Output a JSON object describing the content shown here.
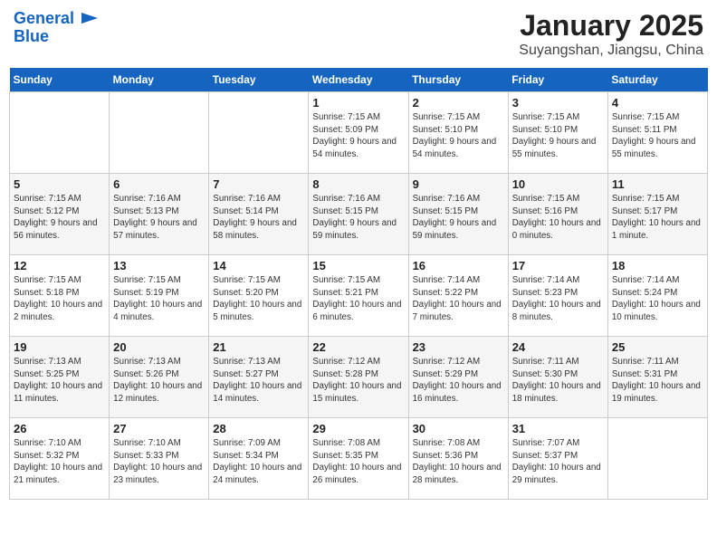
{
  "header": {
    "logo_line1": "General",
    "logo_line2": "Blue",
    "title": "January 2025",
    "subtitle": "Suyangshan, Jiangsu, China"
  },
  "days_of_week": [
    "Sunday",
    "Monday",
    "Tuesday",
    "Wednesday",
    "Thursday",
    "Friday",
    "Saturday"
  ],
  "weeks": [
    [
      {
        "day": "",
        "info": ""
      },
      {
        "day": "",
        "info": ""
      },
      {
        "day": "",
        "info": ""
      },
      {
        "day": "1",
        "info": "Sunrise: 7:15 AM\nSunset: 5:09 PM\nDaylight: 9 hours and 54 minutes."
      },
      {
        "day": "2",
        "info": "Sunrise: 7:15 AM\nSunset: 5:10 PM\nDaylight: 9 hours and 54 minutes."
      },
      {
        "day": "3",
        "info": "Sunrise: 7:15 AM\nSunset: 5:10 PM\nDaylight: 9 hours and 55 minutes."
      },
      {
        "day": "4",
        "info": "Sunrise: 7:15 AM\nSunset: 5:11 PM\nDaylight: 9 hours and 55 minutes."
      }
    ],
    [
      {
        "day": "5",
        "info": "Sunrise: 7:15 AM\nSunset: 5:12 PM\nDaylight: 9 hours and 56 minutes."
      },
      {
        "day": "6",
        "info": "Sunrise: 7:16 AM\nSunset: 5:13 PM\nDaylight: 9 hours and 57 minutes."
      },
      {
        "day": "7",
        "info": "Sunrise: 7:16 AM\nSunset: 5:14 PM\nDaylight: 9 hours and 58 minutes."
      },
      {
        "day": "8",
        "info": "Sunrise: 7:16 AM\nSunset: 5:15 PM\nDaylight: 9 hours and 59 minutes."
      },
      {
        "day": "9",
        "info": "Sunrise: 7:16 AM\nSunset: 5:15 PM\nDaylight: 9 hours and 59 minutes."
      },
      {
        "day": "10",
        "info": "Sunrise: 7:15 AM\nSunset: 5:16 PM\nDaylight: 10 hours and 0 minutes."
      },
      {
        "day": "11",
        "info": "Sunrise: 7:15 AM\nSunset: 5:17 PM\nDaylight: 10 hours and 1 minute."
      }
    ],
    [
      {
        "day": "12",
        "info": "Sunrise: 7:15 AM\nSunset: 5:18 PM\nDaylight: 10 hours and 2 minutes."
      },
      {
        "day": "13",
        "info": "Sunrise: 7:15 AM\nSunset: 5:19 PM\nDaylight: 10 hours and 4 minutes."
      },
      {
        "day": "14",
        "info": "Sunrise: 7:15 AM\nSunset: 5:20 PM\nDaylight: 10 hours and 5 minutes."
      },
      {
        "day": "15",
        "info": "Sunrise: 7:15 AM\nSunset: 5:21 PM\nDaylight: 10 hours and 6 minutes."
      },
      {
        "day": "16",
        "info": "Sunrise: 7:14 AM\nSunset: 5:22 PM\nDaylight: 10 hours and 7 minutes."
      },
      {
        "day": "17",
        "info": "Sunrise: 7:14 AM\nSunset: 5:23 PM\nDaylight: 10 hours and 8 minutes."
      },
      {
        "day": "18",
        "info": "Sunrise: 7:14 AM\nSunset: 5:24 PM\nDaylight: 10 hours and 10 minutes."
      }
    ],
    [
      {
        "day": "19",
        "info": "Sunrise: 7:13 AM\nSunset: 5:25 PM\nDaylight: 10 hours and 11 minutes."
      },
      {
        "day": "20",
        "info": "Sunrise: 7:13 AM\nSunset: 5:26 PM\nDaylight: 10 hours and 12 minutes."
      },
      {
        "day": "21",
        "info": "Sunrise: 7:13 AM\nSunset: 5:27 PM\nDaylight: 10 hours and 14 minutes."
      },
      {
        "day": "22",
        "info": "Sunrise: 7:12 AM\nSunset: 5:28 PM\nDaylight: 10 hours and 15 minutes."
      },
      {
        "day": "23",
        "info": "Sunrise: 7:12 AM\nSunset: 5:29 PM\nDaylight: 10 hours and 16 minutes."
      },
      {
        "day": "24",
        "info": "Sunrise: 7:11 AM\nSunset: 5:30 PM\nDaylight: 10 hours and 18 minutes."
      },
      {
        "day": "25",
        "info": "Sunrise: 7:11 AM\nSunset: 5:31 PM\nDaylight: 10 hours and 19 minutes."
      }
    ],
    [
      {
        "day": "26",
        "info": "Sunrise: 7:10 AM\nSunset: 5:32 PM\nDaylight: 10 hours and 21 minutes."
      },
      {
        "day": "27",
        "info": "Sunrise: 7:10 AM\nSunset: 5:33 PM\nDaylight: 10 hours and 23 minutes."
      },
      {
        "day": "28",
        "info": "Sunrise: 7:09 AM\nSunset: 5:34 PM\nDaylight: 10 hours and 24 minutes."
      },
      {
        "day": "29",
        "info": "Sunrise: 7:08 AM\nSunset: 5:35 PM\nDaylight: 10 hours and 26 minutes."
      },
      {
        "day": "30",
        "info": "Sunrise: 7:08 AM\nSunset: 5:36 PM\nDaylight: 10 hours and 28 minutes."
      },
      {
        "day": "31",
        "info": "Sunrise: 7:07 AM\nSunset: 5:37 PM\nDaylight: 10 hours and 29 minutes."
      },
      {
        "day": "",
        "info": ""
      }
    ]
  ]
}
